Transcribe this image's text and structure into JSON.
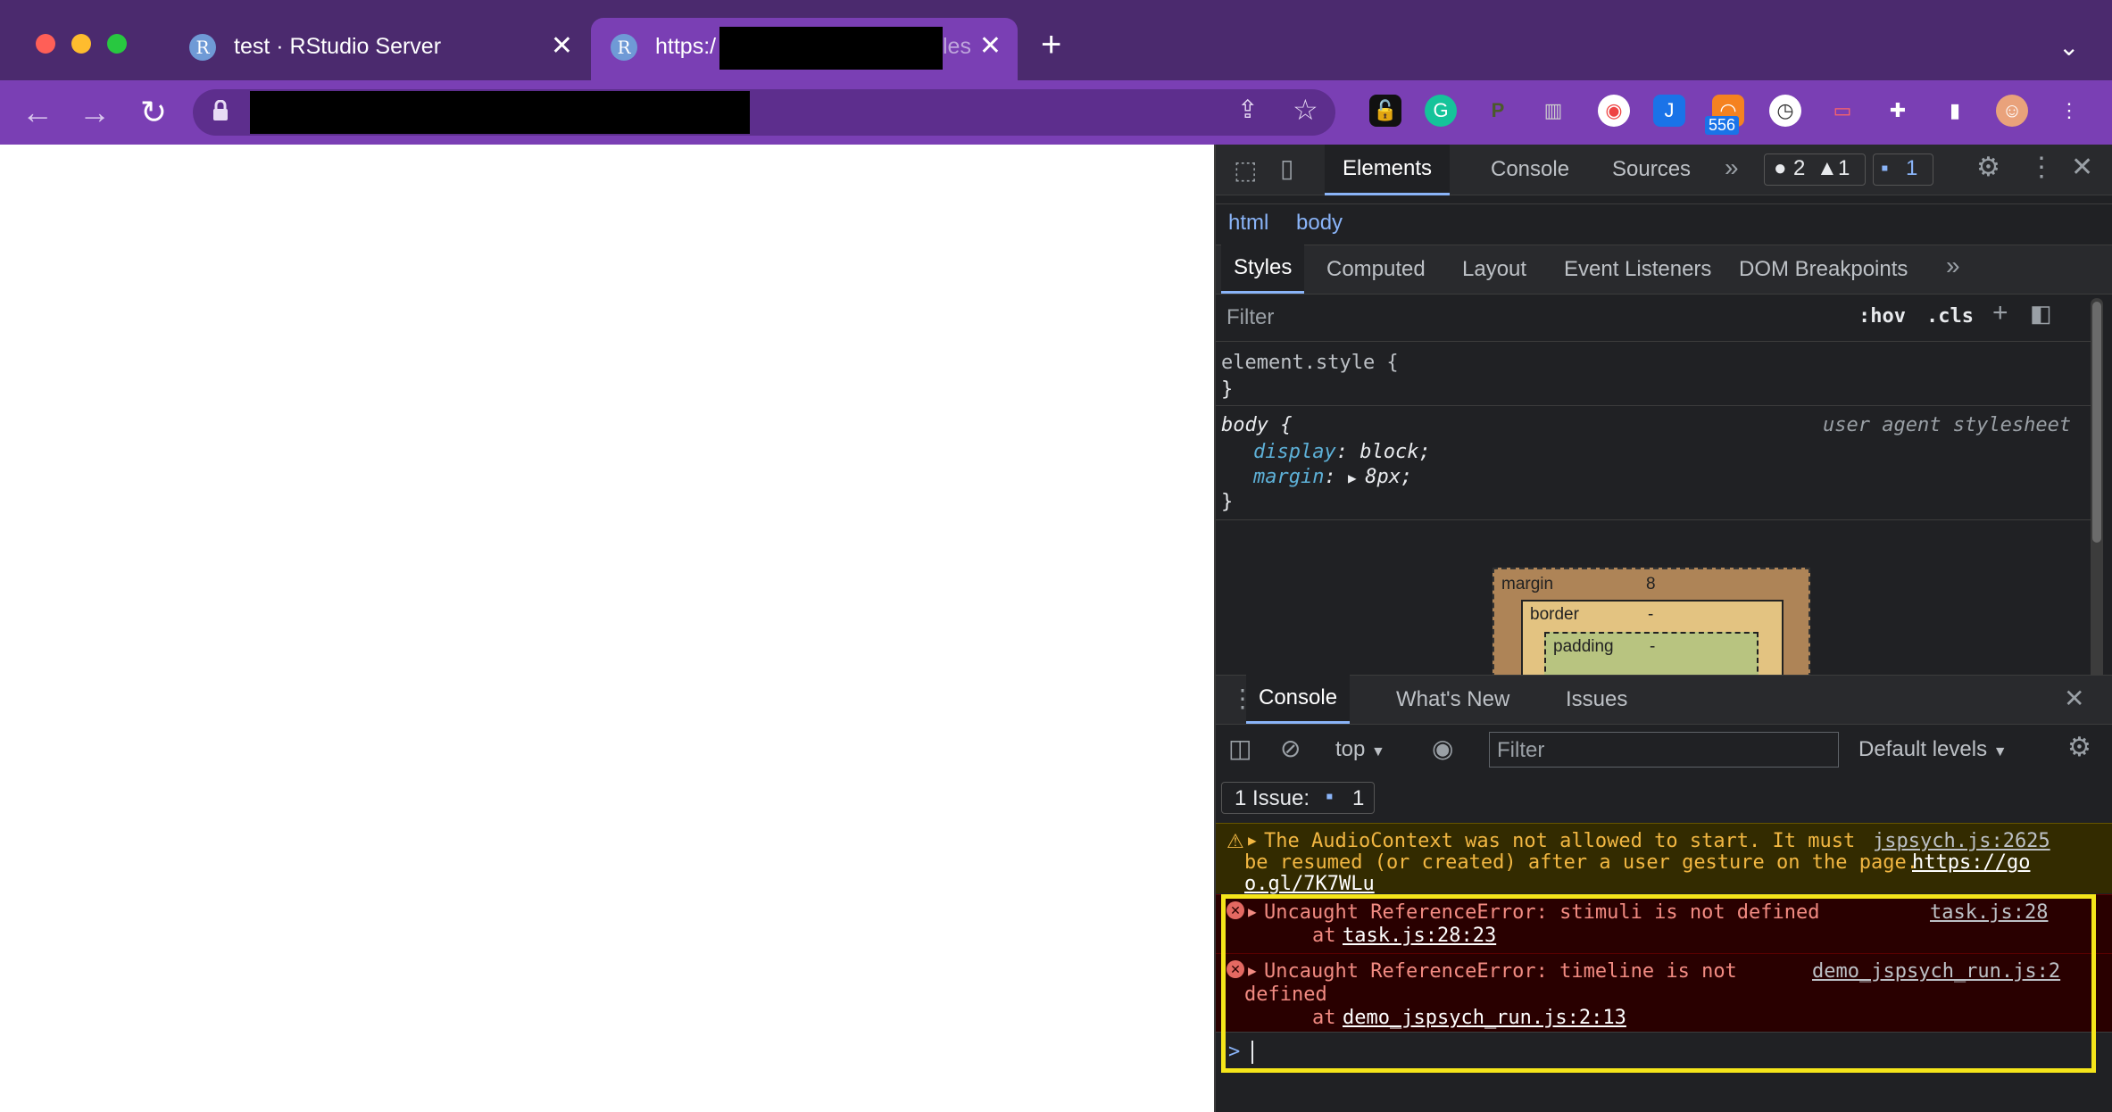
{
  "browser": {
    "tabs": [
      {
        "title": "test · RStudio Server",
        "favicon": "R"
      },
      {
        "title": "https:/",
        "favicon": "R",
        "trail": "les"
      }
    ],
    "extension_badge": "556",
    "colors": {
      "tabbar": "#4b2a6e",
      "toolbar": "#7a3fb4",
      "devtools_bg": "#202124",
      "error_text": "#f28b82",
      "warning_text": "#f2b742",
      "highlight": "#f5e51a"
    }
  },
  "devtools": {
    "main_tabs": [
      "Elements",
      "Console",
      "Sources"
    ],
    "counts": {
      "errors": "2",
      "warnings": "1",
      "issues": "1"
    },
    "breadcrumb": [
      "html",
      "body"
    ],
    "sub_tabs": [
      "Styles",
      "Computed",
      "Layout",
      "Event Listeners",
      "DOM Breakpoints"
    ],
    "filter_placeholder": "Filter",
    "hov": ":hov",
    "cls": ".cls",
    "element_style": "element.style {",
    "close_brace": "}",
    "body_rule": {
      "selector": "body {",
      "source": "user agent stylesheet",
      "prop1": "display",
      "val1": "block;",
      "prop2": "margin",
      "val2": "8px;"
    },
    "box_model": {
      "margin_label": "margin",
      "margin_value": "8",
      "border_label": "border",
      "border_value": "-",
      "padding_label": "padding",
      "padding_value": "-"
    },
    "drawer_tabs": [
      "Console",
      "What's New",
      "Issues"
    ],
    "console_toolbar": {
      "context": "top",
      "filter_placeholder": "Filter",
      "levels": "Default levels"
    },
    "issue_bar": {
      "label": "1 Issue:",
      "count": "1"
    },
    "messages": {
      "warning": {
        "line1": "The AudioContext was not allowed to start. It must",
        "line2": "be resumed (or created) after a user gesture on the page.",
        "url1": "https://go",
        "url2": "o.gl/7K7WLu",
        "source": "jspsych.js:2625"
      },
      "error1": {
        "text": "Uncaught ReferenceError: stimuli is not defined",
        "at": "at",
        "link": "task.js:28:23",
        "source": "task.js:28"
      },
      "error2": {
        "text1": "Uncaught ReferenceError: timeline is not",
        "text2": "defined",
        "at": "at",
        "link": "demo_jspsych_run.js:2:13",
        "source": "demo_jspsych_run.js:2"
      }
    },
    "prompt": ">"
  }
}
